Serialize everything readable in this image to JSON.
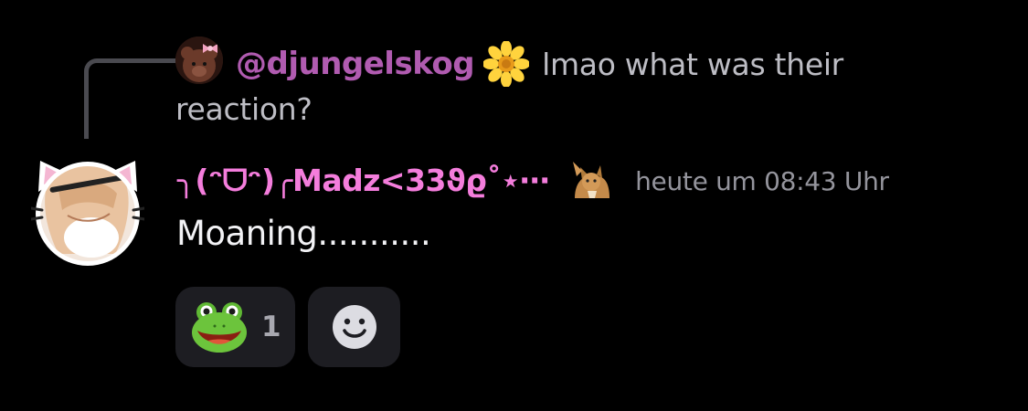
{
  "reply": {
    "author": "@djungelskog",
    "author_icon": "sunflower-icon",
    "text_line1": "lmao what was their",
    "text_line2": "reaction?"
  },
  "message": {
    "author": "╮(ᵔᗜᵔ)╭Madz<33ϑϱ˚⋆⋯",
    "badge_icon": "cat-badge-icon",
    "timestamp": "heute um 08:43 Uhr",
    "text": "Moaning..........."
  },
  "reactions": [
    {
      "emoji": "frog-icon",
      "count": "1"
    },
    {
      "emoji": "add-reaction-smiley-icon"
    }
  ],
  "colors": {
    "reply_author": "#b05bb0",
    "author": "#f47ddc",
    "timestamp": "#94949c",
    "reaction_bg": "#1d1d22"
  }
}
